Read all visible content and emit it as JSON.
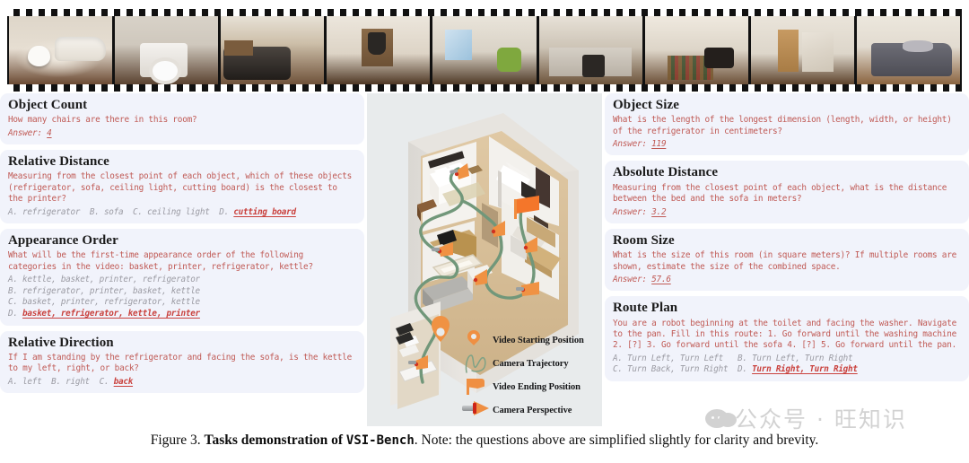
{
  "filmstrip": {
    "name": "video-frames",
    "frames": [
      {
        "label": "bathroom with bathtub and toilet"
      },
      {
        "label": "laundry room with washing machine"
      },
      {
        "label": "living room with dark leather sofa"
      },
      {
        "label": "hallway with coats on door"
      },
      {
        "label": "room with desk and green office chair"
      },
      {
        "label": "kitchen with oven and cabinets"
      },
      {
        "label": "shelf with bottles and black bag"
      },
      {
        "label": "bedroom with wardrobe and mirror"
      },
      {
        "label": "bedroom with grey double bed"
      }
    ]
  },
  "left_column": [
    {
      "title": "Object Count",
      "question": "How many chairs are there in this room?",
      "answer_label": "Answer:",
      "answer_value": "4",
      "options": []
    },
    {
      "title": "Relative Distance",
      "question": "Measuring from the closest point of each object, which of these objects (refrigerator, sofa, ceiling light, cutting board) is the closest to the printer?",
      "answer_label": "",
      "answer_value": "",
      "options": [
        {
          "text": "A. refrigerator  B. sofa  C. ceiling light  D. ",
          "correct": "cutting board",
          "inline": true
        }
      ]
    },
    {
      "title": "Appearance Order",
      "question": "What will be the first-time appearance order of the following categories in the video: basket, printer, refrigerator, kettle?",
      "answer_label": "",
      "answer_value": "",
      "options": [
        {
          "text": "A. kettle, basket, printer, refrigerator",
          "correct": "",
          "inline": false
        },
        {
          "text": "B. refrigerator, printer, basket, kettle",
          "correct": "",
          "inline": false
        },
        {
          "text": "C. basket, printer, refrigerator, kettle",
          "correct": "",
          "inline": false
        },
        {
          "text": "D. ",
          "correct": "basket, refrigerator, kettle, printer",
          "inline": false
        }
      ]
    },
    {
      "title": "Relative Direction",
      "question": "If I am standing by the refrigerator and facing the sofa, is the kettle to my left, right, or back?",
      "answer_label": "",
      "answer_value": "",
      "options": [
        {
          "text": "A. left  B. right  C. ",
          "correct": "back",
          "inline": true
        }
      ]
    }
  ],
  "right_column": [
    {
      "title": "Object Size",
      "question": "What is the length of the longest dimension (length, width, or height) of the refrigerator in centimeters?",
      "answer_label": "Answer:",
      "answer_value": "119",
      "options": []
    },
    {
      "title": "Absolute Distance",
      "question": "Measuring from the closest point of each object, what is the distance between the bed and the sofa in meters?",
      "answer_label": "Answer:",
      "answer_value": "3.2",
      "options": []
    },
    {
      "title": "Room Size",
      "question": "What is the size of this room (in square meters)? If multiple rooms are shown, estimate the size of the combined space.",
      "answer_label": "Answer:",
      "answer_value": "57.6",
      "options": []
    },
    {
      "title": "Route Plan",
      "question": "You are a robot beginning at the toilet and facing the washer. Navigate to the pan. Fill in this route: 1. Go forward until the washing machine 2. [?] 3. Go forward until the sofa 4. [?] 5. Go forward until the pan.",
      "answer_label": "",
      "answer_value": "",
      "options": [
        {
          "text": "A. Turn Left, Turn Left   B. Turn Left, Turn Right",
          "correct": "",
          "inline": false
        },
        {
          "text": "C. Turn Back, Turn Right  D. ",
          "correct": "Turn Right, Turn Right",
          "inline": false
        }
      ]
    }
  ],
  "middle_panel": {
    "name": "floor-plan-3d",
    "description": "Isometric 3D floor plan of an apartment with bedrooms, living room, kitchen and bathroom showing a green camera trajectory",
    "legend_items": [
      {
        "icon": "map-pin-icon",
        "label": "Video Starting Position"
      },
      {
        "icon": "trajectory-squiggle-icon",
        "label": "Camera Trajectory"
      },
      {
        "icon": "flag-icon",
        "label": "Video Ending Position"
      },
      {
        "icon": "camera-cone-icon",
        "label": "Camera Perspective"
      }
    ]
  },
  "caption": {
    "prefix": "Figure 3. ",
    "bold_part": "Tasks demonstration of ",
    "mono_part": "VSI-Bench",
    "suffix": ". Note: the questions above are simplified slightly for clarity and brevity."
  },
  "watermark": {
    "text": "公众号 · 旺知识"
  },
  "colors": {
    "card_bg": "#f1f3fb",
    "question_text": "#c05a55",
    "option_text": "#9b9ba3",
    "correct_text": "#c9403c",
    "accent_orange": "#ef8f42",
    "trajectory_green": "#6f9475",
    "panel_bg": "#e8ebec"
  }
}
